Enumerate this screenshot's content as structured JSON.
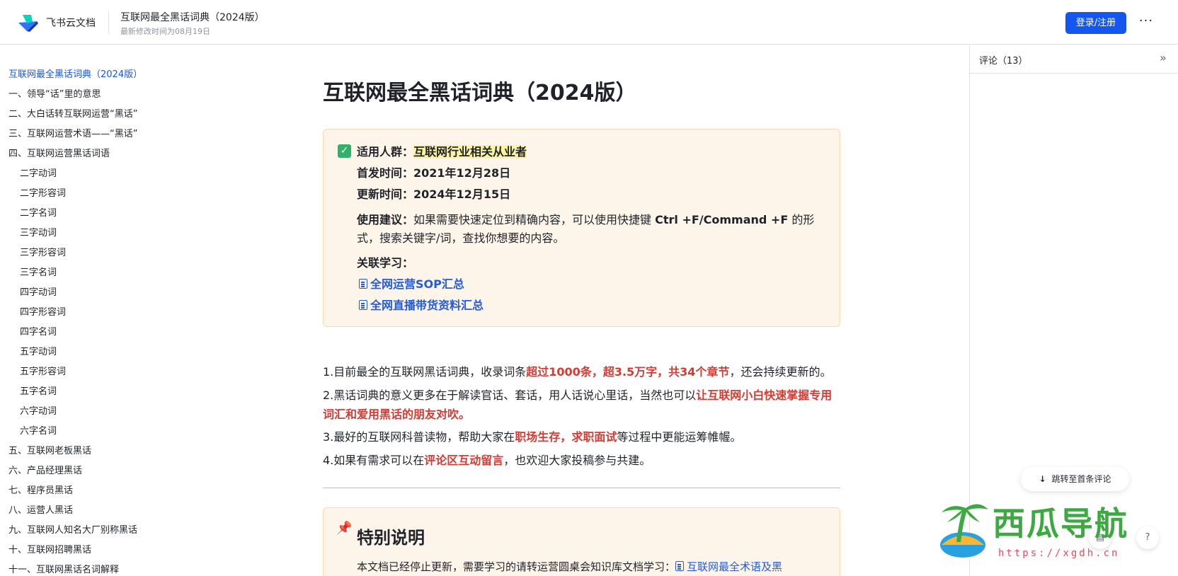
{
  "header": {
    "brand": "飞书云文档",
    "doc_title": "互联网最全黑话词典（2024版）",
    "doc_subtitle": "最新修改时间为08月19日",
    "login_label": "登录/注册",
    "more_label": "···"
  },
  "toc": {
    "items": [
      {
        "label": "互联网最全黑话词典（2024版）",
        "active": true,
        "sub": false
      },
      {
        "label": "一、领导“话”里的意思",
        "sub": false
      },
      {
        "label": "二、大白话转互联网运营“黑话”",
        "sub": false
      },
      {
        "label": "三、互联网运营术语——“黑话”",
        "sub": false
      },
      {
        "label": "四、互联网运营黑话词语",
        "sub": false
      },
      {
        "label": "二字动词",
        "sub": true
      },
      {
        "label": "二字形容词",
        "sub": true
      },
      {
        "label": "二字名词",
        "sub": true
      },
      {
        "label": "三字动词",
        "sub": true
      },
      {
        "label": "三字形容词",
        "sub": true
      },
      {
        "label": "三字名词",
        "sub": true
      },
      {
        "label": "四字动词",
        "sub": true
      },
      {
        "label": "四字形容词",
        "sub": true
      },
      {
        "label": "四字名词",
        "sub": true
      },
      {
        "label": "五字动词",
        "sub": true
      },
      {
        "label": "五字形容词",
        "sub": true
      },
      {
        "label": "五字名词",
        "sub": true
      },
      {
        "label": "六字动词",
        "sub": true
      },
      {
        "label": "六字名词",
        "sub": true
      },
      {
        "label": "五、互联网老板黑话",
        "sub": false
      },
      {
        "label": "六、产品经理黑话",
        "sub": false
      },
      {
        "label": "七、程序员黑话",
        "sub": false
      },
      {
        "label": "八、运营人黑话",
        "sub": false
      },
      {
        "label": "九、互联网人知名大厂别称黑话",
        "sub": false
      },
      {
        "label": "十、互联网招聘黑话",
        "sub": false
      },
      {
        "label": "十一、互联网黑话名词解释",
        "sub": false
      }
    ]
  },
  "main": {
    "title": "互联网最全黑话词典（2024版）",
    "callout": {
      "audience_label": "适用人群：",
      "audience_value": "互联网行业相关从业者",
      "first_label": "首发时间：",
      "first_value": "2021年12月28日",
      "update_label": "更新时间：",
      "update_value": "2024年12月15日",
      "usage_label": "使用建议：",
      "usage_text_1": "如果需要快速定位到精确内容，可以使用快捷键 ",
      "usage_shortcut": "Ctrl +F/Command +F",
      "usage_text_2": " 的形式，搜索关键字/词，查找你想要的内容。",
      "related_label": "关联学习：",
      "link_1": "全网运营SOP汇总",
      "link_2": "全网直播带货资料汇总"
    },
    "p1_a": "1.目前最全的互联网黑话词典，收录词条",
    "p1_red": "超过1000条，超3.5万字，共34个章节",
    "p1_b": "，还会持续更新的。",
    "p2_a": "2.黑话词典的意义更多在于解读官话、套话，用人话说心里话，当然也可以",
    "p2_red": "让互联网小白快速掌握专用词汇和爱用黑话的朋友对吹。",
    "p3_a": "3.最好的互联网科普读物，帮助大家在",
    "p3_red1": "职场生存",
    "p3_sep": "，",
    "p3_red2": "求职面试",
    "p3_b": "等过程中更能运筹帷幄。",
    "p4_a": "4.如果有需求可以在",
    "p4_red": "评论区互动留言",
    "p4_b": "，也欢迎大家投稿参与共建。",
    "special": {
      "title": "特别说明",
      "text": "本文档已经停止更新，需要学习的请转运营圆桌会知识库文档学习：",
      "link": "互联网最全术语及黑"
    }
  },
  "comments": {
    "title": "评论（13）",
    "jump_label": "跳转至首条评论"
  },
  "watermark": {
    "title": "西瓜导航",
    "url": "https://xgdh.cn"
  },
  "colors": {
    "accent": "#1456f0",
    "link": "#245bdb",
    "highlight_red": "#d83931",
    "callout_bg": "#fef5ea"
  }
}
